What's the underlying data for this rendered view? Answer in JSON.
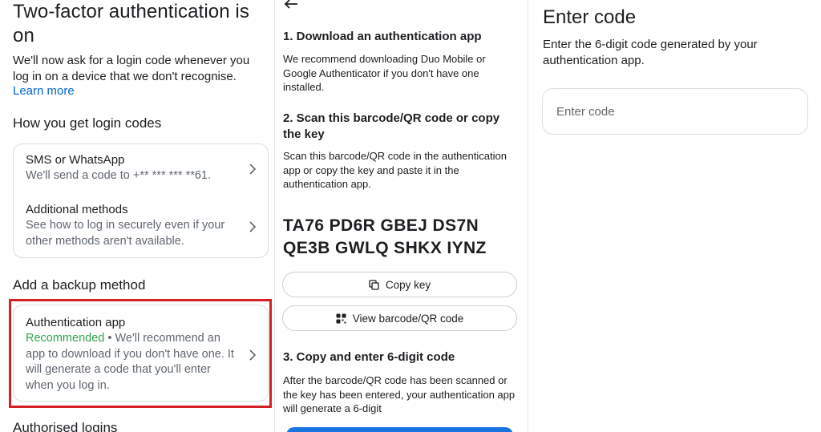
{
  "panel1": {
    "title": "Two-factor authentication is on",
    "description": "We'll now ask for a login code whenever you log in on a device that we don't recognise.",
    "learn_more": "Learn more",
    "login_codes_heading": "How you get login codes",
    "methods": [
      {
        "title": "SMS or WhatsApp",
        "subtitle": "We'll send a code to +** *** *** **61."
      },
      {
        "title": "Additional methods",
        "subtitle": "See how to log in securely even if your other methods aren't available."
      }
    ],
    "backup_heading": "Add a backup method",
    "backup_option": {
      "title": "Authentication app",
      "recommended": "Recommended",
      "subtitle": " • We'll recommend an app to download if you don't have one. It will generate a code that you'll enter when you log in."
    },
    "authorised_logins": "Authorised logins",
    "highlight_color": "#d32024"
  },
  "panel2": {
    "step1_title": "1. Download an authentication app",
    "step1_desc": "We recommend downloading Duo Mobile or Google Authenticator if you don't have one installed.",
    "step2_title": "2. Scan this barcode/QR code or copy the key",
    "step2_desc": "Scan this barcode/QR code in the authentication app or copy the key and paste it in the authentication app.",
    "key_line1": "TA76 PD6R GBEJ DS7N",
    "key_line2": "QE3B GWLQ SHKX IYNZ",
    "copy_key": "Copy key",
    "view_qr": "View barcode/QR code",
    "step3_title": "3. Copy and enter 6-digit code",
    "step3_desc": "After the barcode/QR code has been scanned or the key has been entered, your authentication app will generate a 6-digit",
    "button_color": "#1b74e4"
  },
  "panel3": {
    "title": "Enter code",
    "description": "Enter the 6-digit code generated by your authentication app.",
    "input_placeholder": "Enter code",
    "input_value": ""
  },
  "icons": {
    "back": "back-arrow-icon",
    "chevron": "chevron-right-icon",
    "copy": "copy-icon",
    "qr": "qr-code-icon"
  }
}
